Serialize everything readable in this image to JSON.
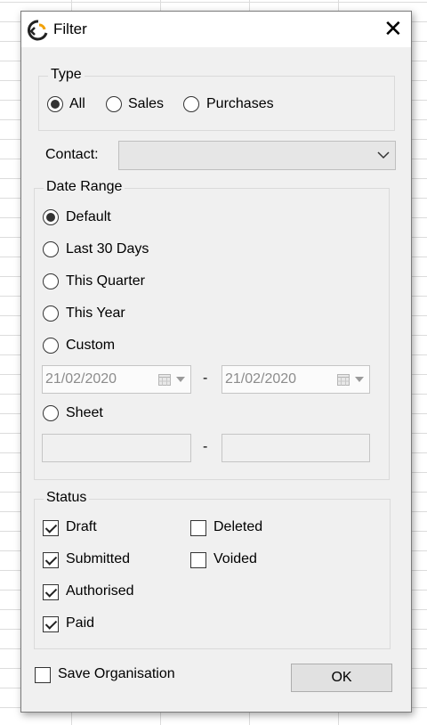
{
  "window": {
    "title": "Filter",
    "close_glyph": "✕"
  },
  "type_group": {
    "legend": "Type",
    "options": [
      {
        "label": "All",
        "selected": true
      },
      {
        "label": "Sales",
        "selected": false
      },
      {
        "label": "Purchases",
        "selected": false
      }
    ]
  },
  "contact": {
    "label": "Contact:",
    "value": ""
  },
  "date_range": {
    "legend": "Date Range",
    "options": [
      {
        "label": "Default",
        "selected": true
      },
      {
        "label": "Last 30 Days",
        "selected": false
      },
      {
        "label": "This Quarter",
        "selected": false
      },
      {
        "label": "This Year",
        "selected": false
      },
      {
        "label": "Custom",
        "selected": false
      },
      {
        "label": "Sheet",
        "selected": false
      }
    ],
    "custom_from": "21/02/2020",
    "custom_to": "21/02/2020",
    "separator": "-",
    "sheet_from": "",
    "sheet_to": ""
  },
  "status": {
    "legend": "Status",
    "items": [
      {
        "label": "Draft",
        "checked": true
      },
      {
        "label": "Submitted",
        "checked": true
      },
      {
        "label": "Authorised",
        "checked": true
      },
      {
        "label": "Paid",
        "checked": true
      },
      {
        "label": "Deleted",
        "checked": false
      },
      {
        "label": "Voided",
        "checked": false
      }
    ]
  },
  "save_org": {
    "label": "Save Organisation",
    "checked": false
  },
  "ok_button": {
    "label": "OK"
  },
  "icons": {
    "app": "app-logo-icon",
    "close": "close-icon",
    "calendar": "calendar-icon",
    "dropdown": "chevron-down-icon"
  }
}
